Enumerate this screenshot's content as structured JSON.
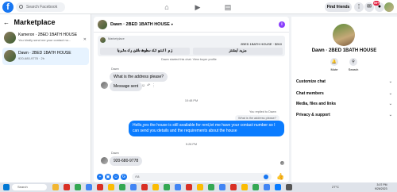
{
  "topbar": {
    "logo": "f",
    "search_placeholder": "Search Facebook",
    "find_friends": "Find friends",
    "notification_count": "99+"
  },
  "sidebar": {
    "title": "Marketplace",
    "conversations": [
      {
        "name": "Kameron · 2BED 1BATH HOUSE",
        "preview": "You kindly send me your contact nu...",
        "close": "✕",
        "selected": false
      },
      {
        "name": "Dawn · 2BED 1BATH HOUSE",
        "preview": "920-680-9778 · 2h",
        "close": "",
        "selected": true
      }
    ]
  },
  "chat": {
    "title": "Dawn · 2BED 1BATH HOUSE",
    "listing": {
      "label": "Marketplace",
      "title": "2BED 1BATH HOUSE · $910",
      "buttons": [
        "زم اکنو ئک ںطوھ ںاشن رک ےئربا",
        "مزید ایشتز"
      ]
    },
    "top_note": "Dawn started this chat. View buyer profile",
    "messages": [
      {
        "sender": "Dawn",
        "text": "What is the address please?"
      },
      {
        "text": "Message sent"
      }
    ],
    "time1": "10:48 PM",
    "reply_note": "You replied to Dawn",
    "reply_quote": "What is the address please?",
    "outgoing": "Hello,yes the house is still available for rent,let me have your contact number so I can send you details and the requirements about the house",
    "time2": "5:28 PM",
    "last_sender": "Dawn",
    "last_message": "920-680-9778",
    "composer_placeholder": "Aa"
  },
  "profile": {
    "name": "Dawn · 2BED 1BATH HOUSE",
    "mute_label": "Mute",
    "search_label": "Search",
    "sections": [
      "Customize chat",
      "Chat members",
      "Media, files and links",
      "Privacy & support"
    ]
  },
  "taskbar": {
    "search_placeholder": "Search",
    "weather": "27°C",
    "time": "3:07 PM",
    "date": "9/26/2023"
  }
}
